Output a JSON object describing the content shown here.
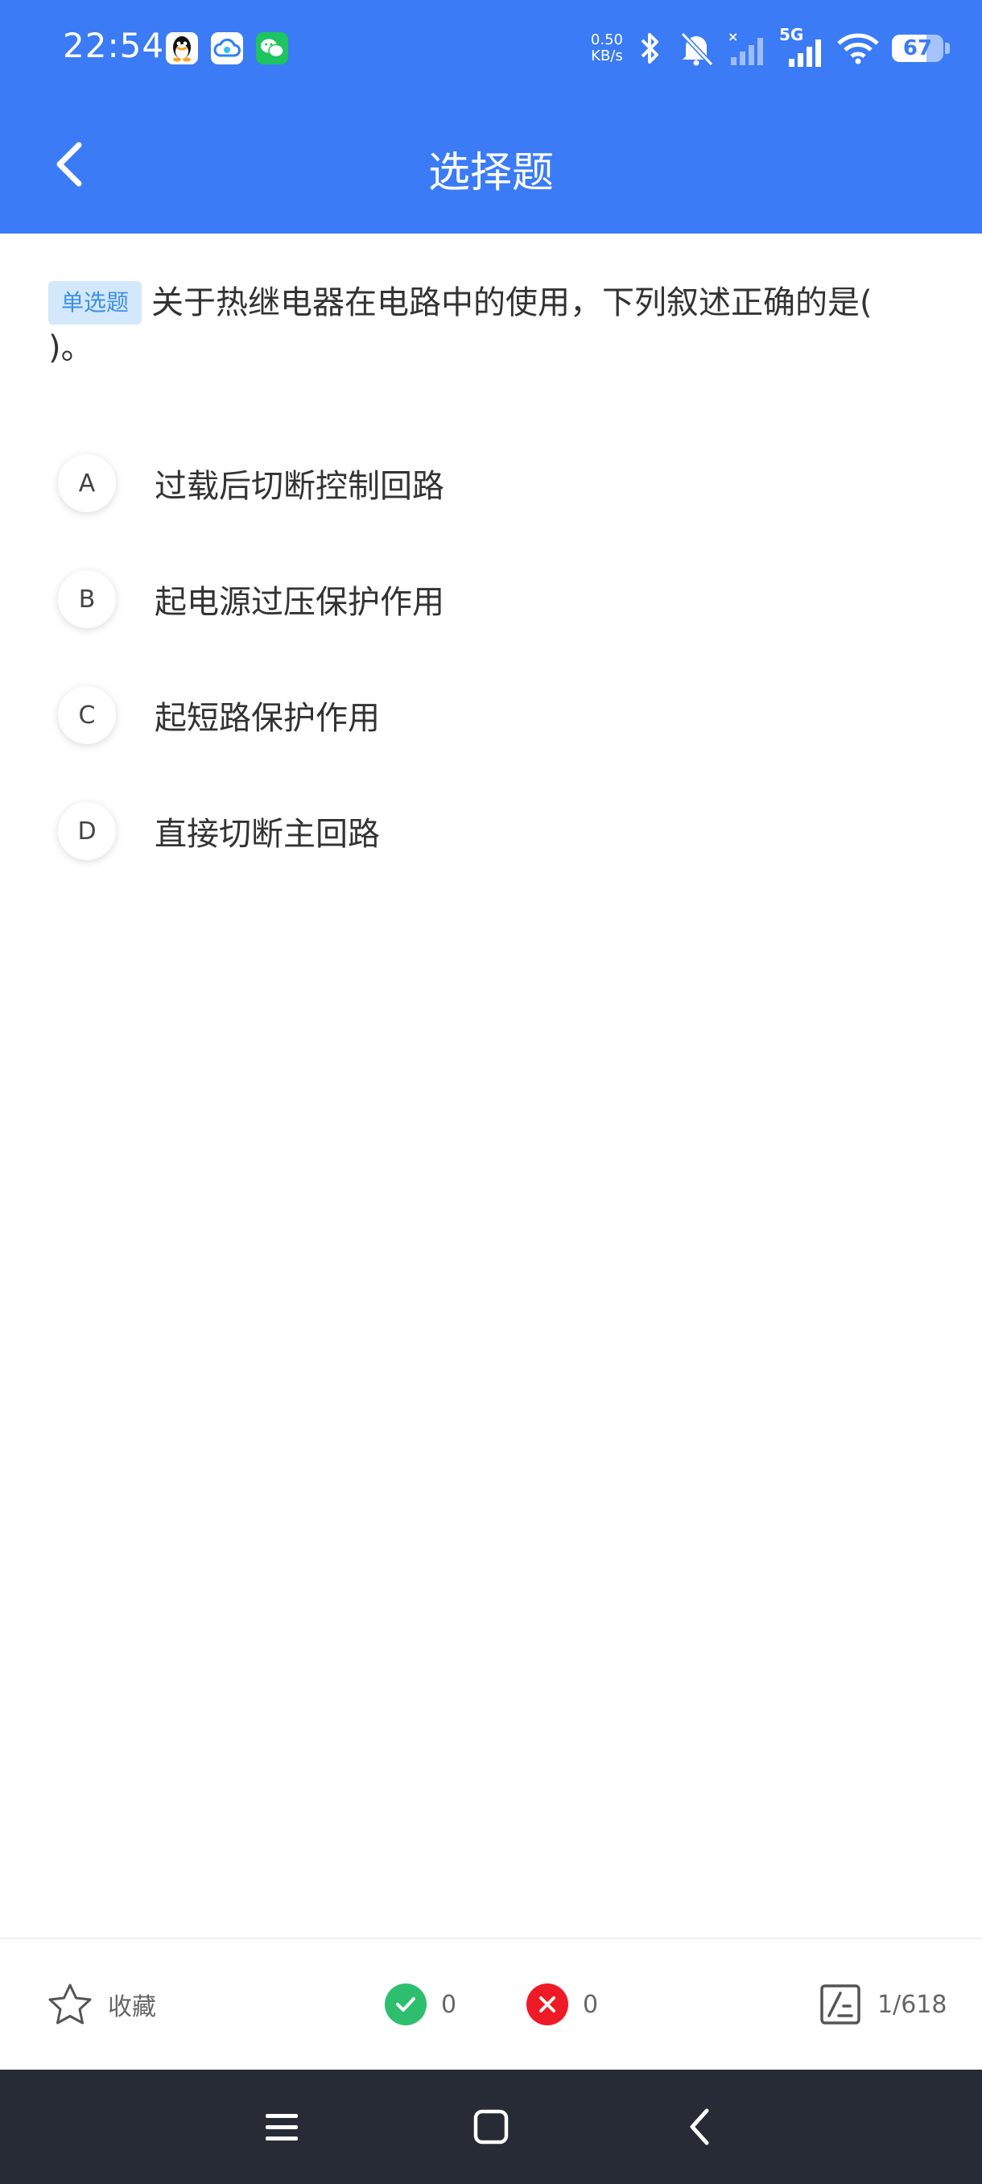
{
  "status_bar": {
    "time": "22:54",
    "net_speed_value": "0.50",
    "net_speed_unit": "KB/s",
    "network": "5G",
    "battery_percent": 67,
    "battery_label": "67",
    "app_icons": [
      "qq-icon",
      "cloud-icon",
      "wechat-icon"
    ]
  },
  "header": {
    "title": "选择题",
    "back_icon": "chevron-left-icon"
  },
  "question": {
    "type_tag": "单选题",
    "text": "关于热继电器在电路中的使用，下列叙述正确的是( )。"
  },
  "options": [
    {
      "letter": "A",
      "text": "过载后切断控制回路"
    },
    {
      "letter": "B",
      "text": "起电源过压保护作用"
    },
    {
      "letter": "C",
      "text": "起短路保护作用"
    },
    {
      "letter": "D",
      "text": "直接切断主回路"
    }
  ],
  "bottom_bar": {
    "favorite_label": "收藏",
    "correct_count": "0",
    "wrong_count": "0",
    "progress": "1/618"
  },
  "colors": {
    "primary": "#3b7bf6",
    "tag_bg": "#d3e8fb",
    "tag_text": "#3e8fe4",
    "correct": "#2dbf6e",
    "wrong": "#ee1a26",
    "navbar": "#262b36"
  }
}
